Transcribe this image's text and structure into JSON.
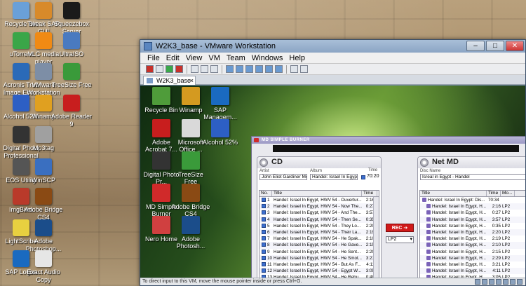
{
  "host_desktop": {
    "icons": [
      {
        "label": "Recycle Bin",
        "icon": "recycle-bin-icon",
        "color": "#6aa0d8"
      },
      {
        "label": "Tweak SAP GUI",
        "icon": "sap-tweak-icon",
        "color": "#d88a2a"
      },
      {
        "label": "Squeezebox Server",
        "icon": "squeezebox-icon",
        "color": "#1a1a1a"
      },
      {
        "label": "uTorrent",
        "icon": "utorrent-icon",
        "color": "#3aa648"
      },
      {
        "label": "VLC media player",
        "icon": "vlc-icon",
        "color": "#f08a14"
      },
      {
        "label": "UltraISO",
        "icon": "ultraiso-icon",
        "color": "#4a7ac0"
      },
      {
        "label": "Acronis True Image Eco...",
        "icon": "acronis-icon",
        "color": "#2a6ab8"
      },
      {
        "label": "VMware Workstation",
        "icon": "vmware-icon",
        "color": "#7d8ea6"
      },
      {
        "label": "TreeSize Free",
        "icon": "treesize-icon",
        "color": "#3a9a3a"
      },
      {
        "label": "Alcohol 52%",
        "icon": "alcohol-icon",
        "color": "#2d5fc4"
      },
      {
        "label": "Winamp",
        "icon": "winamp-icon",
        "color": "#e0a020"
      },
      {
        "label": "Adobe Reader 9",
        "icon": "adobe-reader-icon",
        "color": "#c81e1e"
      },
      {
        "label": "Digital Photo Professional",
        "icon": "photo-professional-icon",
        "color": "#333333"
      },
      {
        "label": "Mp3tag",
        "icon": "mp3tag-icon",
        "color": "#a0a0a0"
      },
      {
        "label": "EOS Utility",
        "icon": "eos-utility-icon",
        "color": "#555555"
      },
      {
        "label": "WinSCP",
        "icon": "winscp-icon",
        "color": "#3a6fc0"
      },
      {
        "label": "ImgBurn",
        "icon": "imgburn-icon",
        "color": "#b93a2a"
      },
      {
        "label": "Adobe Bridge CS4",
        "icon": "adobe-bridge-icon",
        "color": "#8a4a14"
      },
      {
        "label": "LightScribe",
        "icon": "lightscribe-icon",
        "color": "#e8d040"
      },
      {
        "label": "Adobe Photoshop...",
        "icon": "photoshop-icon",
        "color": "#1b4d8a"
      },
      {
        "label": "SAP Logon",
        "icon": "sap-logon-icon",
        "color": "#1a6ac0"
      },
      {
        "label": "Exact Audio Copy",
        "icon": "eac-icon",
        "color": "#e6e6e6"
      }
    ]
  },
  "vm_window": {
    "title": "W2K3_base - VMware Workstation",
    "menu": [
      "File",
      "Edit",
      "View",
      "VM",
      "Team",
      "Windows",
      "Help"
    ],
    "tab_label": "W2K3_base",
    "status_text": "To direct input to this VM, move the mouse pointer inside or press Ctrl+G."
  },
  "guest_desktop": {
    "icons": [
      {
        "label": "Recycle Bin",
        "icon": "recycle-bin-icon",
        "color": "#4f9c3a"
      },
      {
        "label": "Winamp",
        "icon": "winamp-icon",
        "color": "#d49a20"
      },
      {
        "label": "SAP Managem...",
        "icon": "sap-management-icon",
        "color": "#1a6ac0"
      },
      {
        "label": "Adobe Acrobat 7...",
        "icon": "adobe-acrobat-icon",
        "color": "#c81e1e"
      },
      {
        "label": "Microsoft Office ...",
        "icon": "ms-office-icon",
        "color": "#d9d9d9"
      },
      {
        "label": "Alcohol 52%",
        "icon": "alcohol-icon",
        "color": "#2d5fc4"
      },
      {
        "label": "Digital Photo Pr...",
        "icon": "photo-professional-icon",
        "color": "#333333"
      },
      {
        "label": "TreeSize Free",
        "icon": "treesize-icon",
        "color": "#3a9a3a"
      },
      {
        "label": "MD Simple Burner",
        "icon": "md-burner-icon",
        "color": "#d02a2a"
      },
      {
        "label": "Adobe Bridge CS4",
        "icon": "adobe-bridge-icon",
        "color": "#8a4a14"
      },
      {
        "label": "Nero Home",
        "icon": "nero-home-icon",
        "color": "#d04040"
      },
      {
        "label": "Adobe Photosh...",
        "icon": "photoshop-icon",
        "color": "#1b4d8a"
      }
    ]
  },
  "md_burner": {
    "title": "MD SIMPLE BURNER",
    "cd": {
      "heading": "CD",
      "artist_label": "Artist",
      "artist": "John Eliot Gardiner Mont",
      "album_label": "Album",
      "album": "Handel: Israel In Egypt [",
      "time_label": "Time",
      "time": "70:20",
      "columns": [
        "No.",
        "Title",
        "Time"
      ],
      "tracks": [
        {
          "no": "1",
          "title": "Handel: Israel In Egypt, HWV 54 - Ouvertur...",
          "time": "2:16"
        },
        {
          "no": "2",
          "title": "Handel: Israel In Egypt, HWV 54 - Now The...",
          "time": "0:27"
        },
        {
          "no": "3",
          "title": "Handel: Israel In Egypt, HWV 54 - And The...",
          "time": "3:57"
        },
        {
          "no": "4",
          "title": "Handel: Israel In Egypt, HWV 54 - Then Se...",
          "time": "0:35"
        },
        {
          "no": "5",
          "title": "Handel: Israel In Egypt, HWV 54 - They Lo...",
          "time": "2:20"
        },
        {
          "no": "6",
          "title": "Handel: Israel In Egypt, HWV 54 - Their La...",
          "time": "2:19"
        },
        {
          "no": "7",
          "title": "Handel: Israel In Egypt, HWV 54 - He Spak...",
          "time": "2:10"
        },
        {
          "no": "8",
          "title": "Handel: Israel In Egypt, HWV 54 - He Gave...",
          "time": "2:15"
        },
        {
          "no": "9",
          "title": "Handel: Israel In Egypt, HWV 54 - He Sent...",
          "time": "2:29"
        },
        {
          "no": "10",
          "title": "Handel: Israel In Egypt, HWV 54 - He Smot...",
          "time": "3:21"
        },
        {
          "no": "11",
          "title": "Handel: Israel In Egypt, HWV 54 - But As F...",
          "time": "4:11"
        },
        {
          "no": "12",
          "title": "Handel: Israel In Egypt, HWV 54 - Egypt W...",
          "time": "3:05"
        },
        {
          "no": "13",
          "title": "Handel: Israel In Egypt, HWV 54 - He Rebu...",
          "time": "0:48"
        }
      ]
    },
    "rec_label": "REC",
    "mode_value": "LP2",
    "md": {
      "heading": "Net MD",
      "disc_label": "Disc Name",
      "disc_name": "Isreal in Egypt - Handel",
      "columns": [
        "Title",
        "Time",
        "Mo..."
      ],
      "disc_row": {
        "title": "Handel: Israel In Egypt: Dis...",
        "time": "70:34",
        "mode": ""
      },
      "tracks": [
        {
          "title": "Handel: Israel In Egypt, H...",
          "time": "2:16",
          "mode": "LP2"
        },
        {
          "title": "Handel: Israel In Egypt, H...",
          "time": "0:27",
          "mode": "LP2"
        },
        {
          "title": "Handel: Israel In Egypt, H...",
          "time": "3:57",
          "mode": "LP2"
        },
        {
          "title": "Handel: Israel In Egypt, H...",
          "time": "0:35",
          "mode": "LP2"
        },
        {
          "title": "Handel: Israel In Egypt, H...",
          "time": "2:20",
          "mode": "LP2"
        },
        {
          "title": "Handel: Israel In Egypt, H...",
          "time": "2:19",
          "mode": "LP2"
        },
        {
          "title": "Handel: Israel In Egypt, H...",
          "time": "2:10",
          "mode": "LP2"
        },
        {
          "title": "Handel: Israel In Egypt, H...",
          "time": "2:15",
          "mode": "LP2"
        },
        {
          "title": "Handel: Israel In Egypt, H...",
          "time": "2:29",
          "mode": "LP2"
        },
        {
          "title": "Handel: Israel In Egypt, H...",
          "time": "3:21",
          "mode": "LP2"
        },
        {
          "title": "Handel: Israel In Egypt, H...",
          "time": "4:11",
          "mode": "LP2"
        },
        {
          "title": "Handel: Israel In Egypt, H...",
          "time": "3:05",
          "mode": "LP2"
        }
      ]
    }
  }
}
